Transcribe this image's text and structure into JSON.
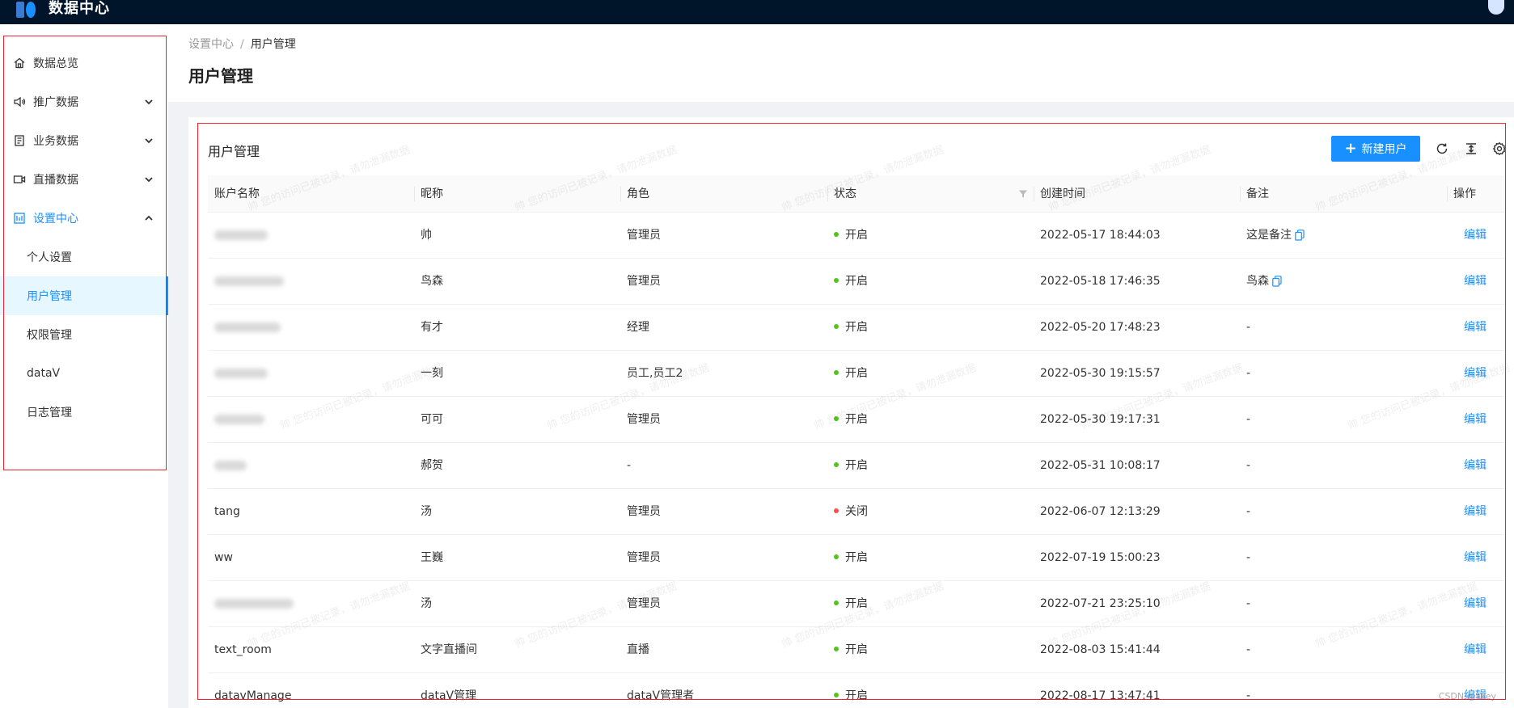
{
  "app": {
    "title": "数据中心"
  },
  "sidebar": {
    "items": [
      {
        "label": "数据总览",
        "icon": "home-icon"
      },
      {
        "label": "推广数据",
        "icon": "speaker-icon"
      },
      {
        "label": "业务数据",
        "icon": "document-icon"
      },
      {
        "label": "直播数据",
        "icon": "video-icon"
      },
      {
        "label": "设置中心",
        "icon": "dashboard-icon"
      }
    ],
    "sub_items": [
      {
        "label": "个人设置"
      },
      {
        "label": "用户管理"
      },
      {
        "label": "权限管理"
      },
      {
        "label": "dataV"
      },
      {
        "label": "日志管理"
      }
    ]
  },
  "breadcrumb": {
    "parent": "设置中心",
    "separator": "/",
    "current": "用户管理"
  },
  "page": {
    "title": "用户管理"
  },
  "card": {
    "title": "用户管理",
    "new_button": "新建用户"
  },
  "table": {
    "columns": [
      "账户名称",
      "昵称",
      "角色",
      "状态",
      "创建时间",
      "备注",
      "操作"
    ],
    "rows": [
      {
        "account": "",
        "nickname": "帅",
        "role": "管理员",
        "status": "开启",
        "created": "2022-05-17 18:44:03",
        "remark": "这是备注",
        "action": "编辑"
      },
      {
        "account": "",
        "nickname": "鸟森",
        "role": "管理员",
        "status": "开启",
        "created": "2022-05-18 17:46:35",
        "remark": "鸟森",
        "action": "编辑"
      },
      {
        "account": "",
        "nickname": "有才",
        "role": "经理",
        "status": "开启",
        "created": "2022-05-20 17:48:23",
        "remark": "-",
        "action": "编辑"
      },
      {
        "account": "",
        "nickname": "一刻",
        "role": "员工,员工2",
        "status": "开启",
        "created": "2022-05-30 19:15:57",
        "remark": "-",
        "action": "编辑"
      },
      {
        "account": "",
        "nickname": "可可",
        "role": "管理员",
        "status": "开启",
        "created": "2022-05-30 19:17:31",
        "remark": "-",
        "action": "编辑"
      },
      {
        "account": "",
        "nickname": "郝贺",
        "role": "-",
        "status": "开启",
        "created": "2022-05-31 10:08:17",
        "remark": "-",
        "action": "编辑"
      },
      {
        "account": "tang",
        "nickname": "汤",
        "role": "管理员",
        "status": "关闭",
        "created": "2022-06-07 12:13:29",
        "remark": "-",
        "action": "编辑"
      },
      {
        "account": "ww",
        "nickname": "王巍",
        "role": "管理员",
        "status": "开启",
        "created": "2022-07-19 15:00:23",
        "remark": "-",
        "action": "编辑"
      },
      {
        "account": "",
        "nickname": "汤",
        "role": "管理员",
        "status": "开启",
        "created": "2022-07-21 23:25:10",
        "remark": "-",
        "action": "编辑"
      },
      {
        "account": "text_room",
        "nickname": "文字直播间",
        "role": "直播",
        "status": "开启",
        "created": "2022-08-03 15:41:44",
        "remark": "-",
        "action": "编辑"
      },
      {
        "account": "datavManage",
        "nickname": "dataV管理",
        "role": "dataV管理者",
        "status": "开启",
        "created": "2022-08-17 13:47:41",
        "remark": "-",
        "action": "编辑"
      }
    ]
  },
  "watermark": "帅 您的访问已被记录，请勿泄漏数据",
  "footer": {
    "credit": "CSDN @likey"
  },
  "colors": {
    "primary": "#1890ff",
    "topbar": "#001529",
    "status_on": "#52c41a",
    "status_off": "#ff4d4f",
    "outline": "#f5222d"
  }
}
